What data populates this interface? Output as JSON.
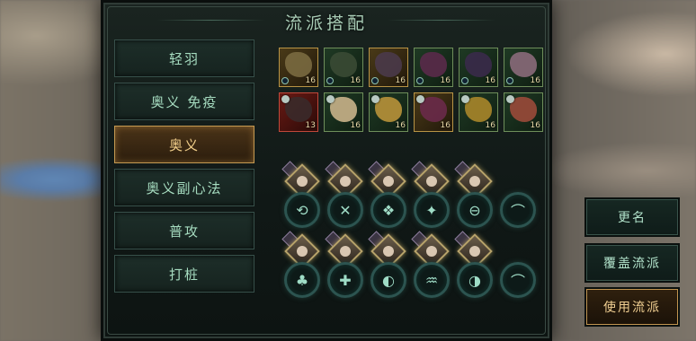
{
  "title": "流派搭配",
  "tabs": [
    "轻羽",
    "奥义 免疫",
    "奥义",
    "奥义副心法",
    "普攻",
    "打桩"
  ],
  "active_tab": "奥义",
  "items_row1": [
    {
      "level": "16",
      "color": "gold",
      "icon": "blade-icon"
    },
    {
      "level": "16",
      "color": "green",
      "icon": "armor-icon"
    },
    {
      "level": "16",
      "color": "gold",
      "icon": "helm-icon"
    },
    {
      "level": "16",
      "color": "green",
      "icon": "gauntlet-icon"
    },
    {
      "level": "16",
      "color": "green",
      "icon": "wing-icon"
    },
    {
      "level": "16",
      "color": "green",
      "icon": "orb-icon"
    }
  ],
  "items_row2": [
    {
      "level": "13",
      "color": "red",
      "icon": "figure-icon"
    },
    {
      "level": "16",
      "color": "green",
      "icon": "robe-icon"
    },
    {
      "level": "16",
      "color": "green",
      "icon": "scroll-icon"
    },
    {
      "level": "16",
      "color": "gold",
      "icon": "bow-icon"
    },
    {
      "level": "16",
      "color": "green",
      "icon": "crest-icon"
    },
    {
      "level": "16",
      "color": "green",
      "icon": "charm-icon"
    }
  ],
  "slot_glyphs_row1": [
    "⟲",
    "✕",
    "❖",
    "✦",
    "⊖",
    "⌒"
  ],
  "slot_glyphs_row2": [
    "♣",
    "✚",
    "◐",
    "♒",
    "◑",
    "⌒"
  ],
  "buttons": {
    "rename": "更名",
    "overwrite": "覆盖流派",
    "use": "使用流派"
  }
}
